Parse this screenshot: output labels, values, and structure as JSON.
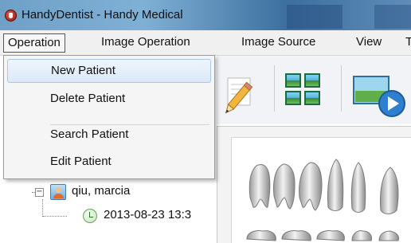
{
  "window": {
    "title": "HandyDentist - Handy Medical"
  },
  "menubar": {
    "items": [
      {
        "label": "Operation"
      },
      {
        "label": "Image Operation"
      },
      {
        "label": "Image Source"
      },
      {
        "label": "View"
      },
      {
        "label": "T"
      }
    ]
  },
  "dropdown": {
    "items": [
      {
        "label": "New Patient"
      },
      {
        "label": "Delete Patient"
      },
      {
        "label": "Search Patient"
      },
      {
        "label": "Edit Patient"
      }
    ]
  },
  "tree": {
    "patient_name": "qiu, marcia",
    "visit_date": "2013-08-23 13:3"
  },
  "icons": {
    "app": "tooth-app-icon",
    "toolbar": [
      "pencil-icon",
      "grid-view-icon",
      "slideshow-play-icon"
    ],
    "tree": [
      "collapse-icon",
      "patient-icon",
      "visit-clock-icon"
    ]
  },
  "colors": {
    "menu_highlight": "#dbe9f8",
    "titlebar": "#6fa0c7"
  }
}
